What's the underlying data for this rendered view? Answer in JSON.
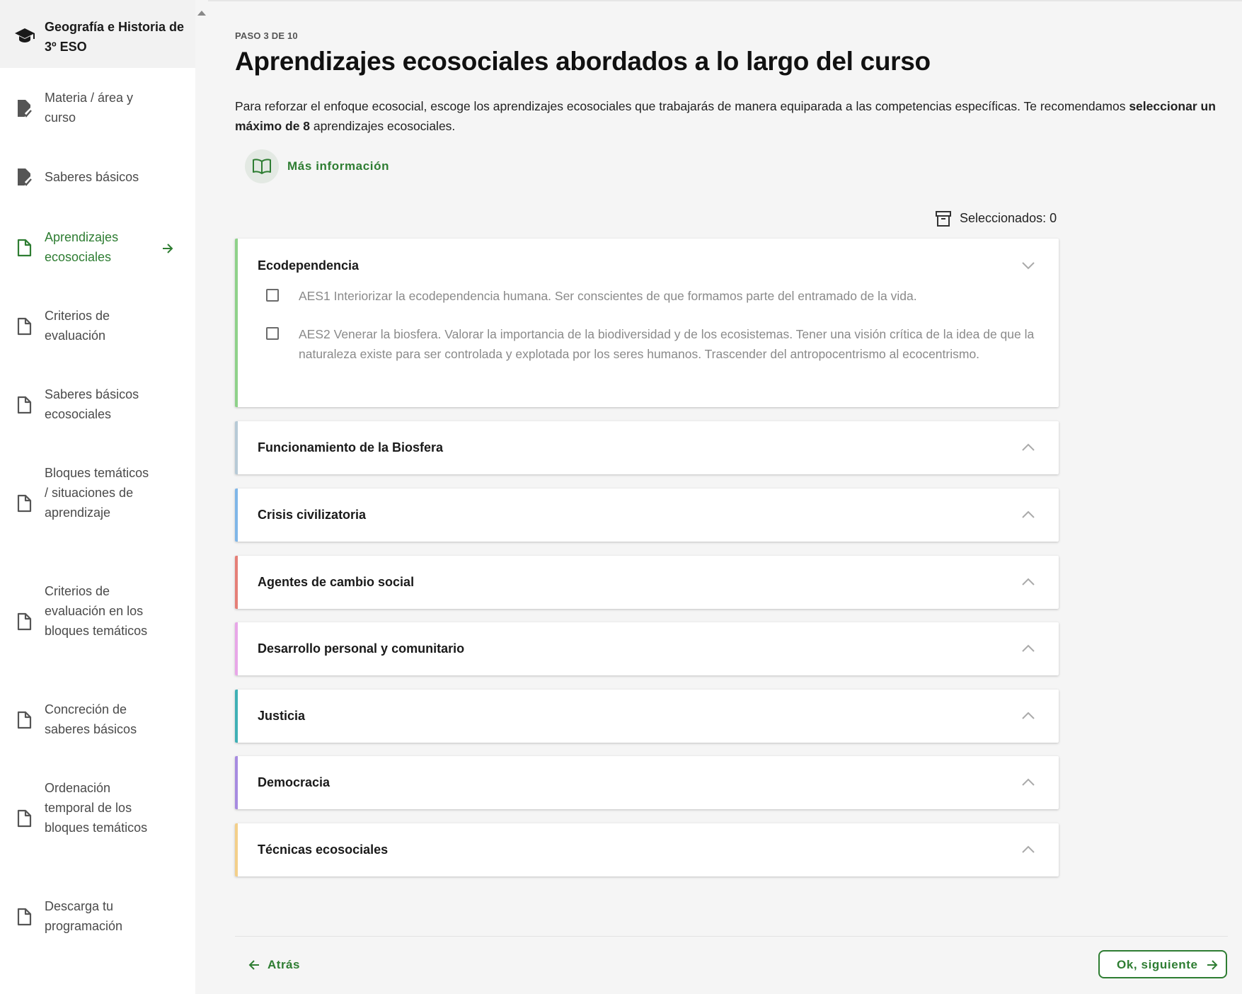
{
  "sidebar": {
    "course_title": "Geografía e Historia de 3º ESO",
    "items": [
      {
        "label": "Materia / área y curso",
        "state": "done",
        "icon": "file-check-icon"
      },
      {
        "label": "Saberes básicos",
        "state": "done",
        "icon": "file-check-icon"
      },
      {
        "label": "Aprendizajes ecosociales",
        "state": "active",
        "icon": "file-icon"
      },
      {
        "label": "Criterios de evaluación",
        "state": "pending",
        "icon": "file-icon"
      },
      {
        "label": "Saberes básicos ecosociales",
        "state": "pending",
        "icon": "file-icon"
      },
      {
        "label": "Bloques temáticos / situaciones de aprendizaje",
        "state": "pending",
        "icon": "file-icon"
      },
      {
        "label": "Criterios de evaluación en los bloques temáticos",
        "state": "pending",
        "icon": "file-icon"
      },
      {
        "label": "Concreción de saberes básicos",
        "state": "pending",
        "icon": "file-icon"
      },
      {
        "label": "Ordenación temporal de los bloques temáticos",
        "state": "pending",
        "icon": "file-icon"
      },
      {
        "label": "Descarga tu programación",
        "state": "pending",
        "icon": "file-icon"
      }
    ]
  },
  "main": {
    "step": "PASO 3 DE 10",
    "title": "Aprendizajes ecosociales abordados a lo largo del curso",
    "intro_part1": "Para reforzar el enfoque ecosocial, escoge los aprendizajes ecosociales que trabajarás de manera equiparada a las competencias específicas. Te recomendamos ",
    "intro_bold": "seleccionar un máximo de 8",
    "intro_part2": " aprendizajes ecosociales.",
    "more_info": "Más información",
    "selected_count": "Seleccionados: 0"
  },
  "categories": [
    {
      "title": "Ecodependencia",
      "color": "#8fd18a",
      "expanded": true,
      "items": [
        {
          "text": "AES1 Interiorizar la ecodependencia humana. Ser conscientes de que formamos parte del entramado de la vida.",
          "checked": false
        },
        {
          "text": "AES2 Venerar la biosfera. Valorar la importancia de la biodiversidad y de los ecosistemas. Tener una visión crítica de la idea de que la naturaleza existe para ser controlada y explotada por los seres humanos. Trascender del antropocentrismo al ecocentrismo.",
          "checked": false
        }
      ]
    },
    {
      "title": "Funcionamiento de la Biosfera",
      "color": "#b7cad6",
      "expanded": false
    },
    {
      "title": "Crisis civilizatoria",
      "color": "#7fb6e8",
      "expanded": false
    },
    {
      "title": "Agentes de cambio social",
      "color": "#e57f77",
      "expanded": false
    },
    {
      "title": "Desarrollo personal y comunitario",
      "color": "#e8a7e8",
      "expanded": false
    },
    {
      "title": "Justicia",
      "color": "#3fb0b5",
      "expanded": false
    },
    {
      "title": "Democracia",
      "color": "#a78be0",
      "expanded": false
    },
    {
      "title": "Técnicas ecosociales",
      "color": "#f3cf8a",
      "expanded": false
    }
  ],
  "footer": {
    "back_label": "Atrás",
    "next_label": "Ok, siguiente"
  },
  "colors": {
    "accent": "#2e7d32",
    "icon_grey": "#555555"
  }
}
